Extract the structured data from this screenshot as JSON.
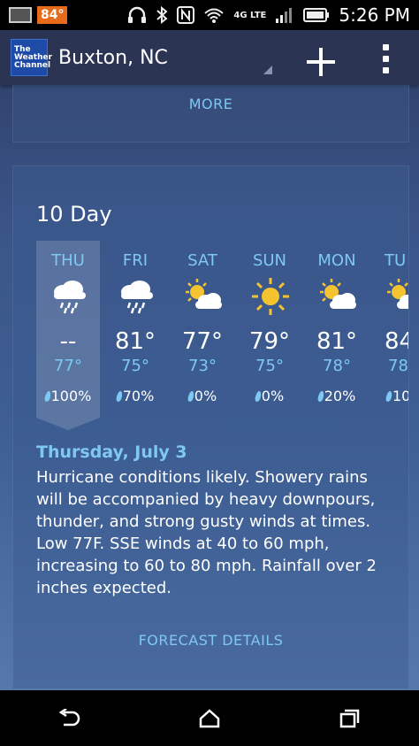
{
  "status_bar": {
    "temperature": "84°",
    "time": "5:26 PM",
    "network": "4G LTE",
    "icons": [
      "gallery-icon",
      "headphones-icon",
      "bluetooth-icon",
      "nfc-icon",
      "wifi-icon",
      "signal-icon",
      "battery-icon"
    ]
  },
  "app_bar": {
    "logo_text": [
      "The",
      "Weather",
      "Channel"
    ],
    "location": "Buxton, NC",
    "add_icon": "plus-icon",
    "menu_icon": "overflow-menu-icon"
  },
  "top_card": {
    "more_label": "MORE"
  },
  "ten_day": {
    "title": "10 Day",
    "days": [
      {
        "name": "THU",
        "icon": "rain-icon",
        "high": "--",
        "low": "77°",
        "precip": "100%"
      },
      {
        "name": "FRI",
        "icon": "rain-icon",
        "high": "81°",
        "low": "75°",
        "precip": "70%"
      },
      {
        "name": "SAT",
        "icon": "partly-cloudy-icon",
        "high": "77°",
        "low": "73°",
        "precip": "0%"
      },
      {
        "name": "SUN",
        "icon": "sunny-icon",
        "high": "79°",
        "low": "75°",
        "precip": "0%"
      },
      {
        "name": "MON",
        "icon": "partly-cloudy-icon",
        "high": "81°",
        "low": "78°",
        "precip": "20%"
      },
      {
        "name": "TU",
        "icon": "partly-cloudy-icon",
        "high": "84",
        "low": "78",
        "precip": "10"
      }
    ],
    "selected_index": 0,
    "detail_heading": "Thursday, July 3",
    "detail_text": "Hurricane conditions likely. Showery rains will be accompanied by heavy downpours, thunder, and strong gusty winds at times. Low 77F. SSE winds at 40 to 60 mph, increasing to 60 to 80 mph. Rainfall over 2 inches expected.",
    "forecast_details_label": "FORECAST DETAILS"
  },
  "nav_bar": {
    "buttons": [
      "back-icon",
      "home-icon",
      "recents-icon"
    ]
  },
  "colors": {
    "accent": "#7ec8f3",
    "appbar": "#2b3453",
    "status_temp": "#e86b1c"
  }
}
